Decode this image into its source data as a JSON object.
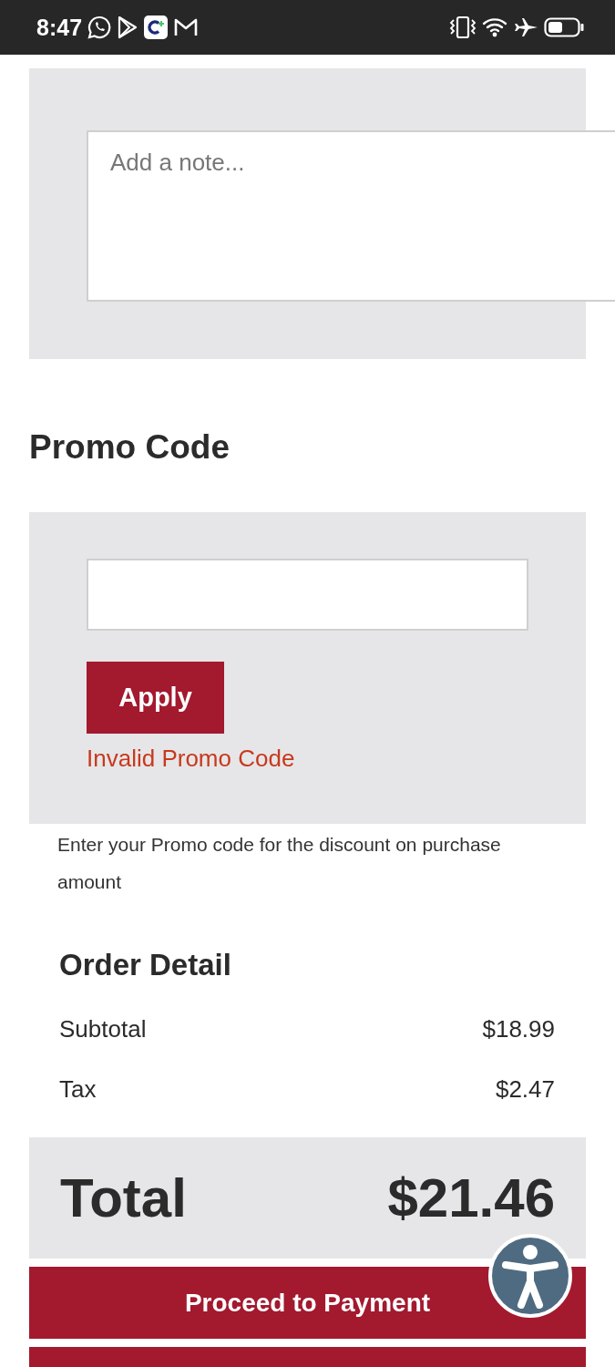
{
  "status_bar": {
    "time": "8:47"
  },
  "note": {
    "placeholder": "Add a note..."
  },
  "promo": {
    "title": "Promo Code",
    "apply": "Apply",
    "error": "Invalid Promo Code",
    "help": "Enter your Promo code for the discount on purchase amount"
  },
  "order_detail": {
    "title": "Order Detail",
    "rows": [
      {
        "label": "Subtotal",
        "value": "$18.99"
      },
      {
        "label": "Tax",
        "value": "$2.47"
      }
    ]
  },
  "total": {
    "label": "Total",
    "value": "$21.46"
  },
  "buttons": [
    "Proceed to Payment"
  ]
}
